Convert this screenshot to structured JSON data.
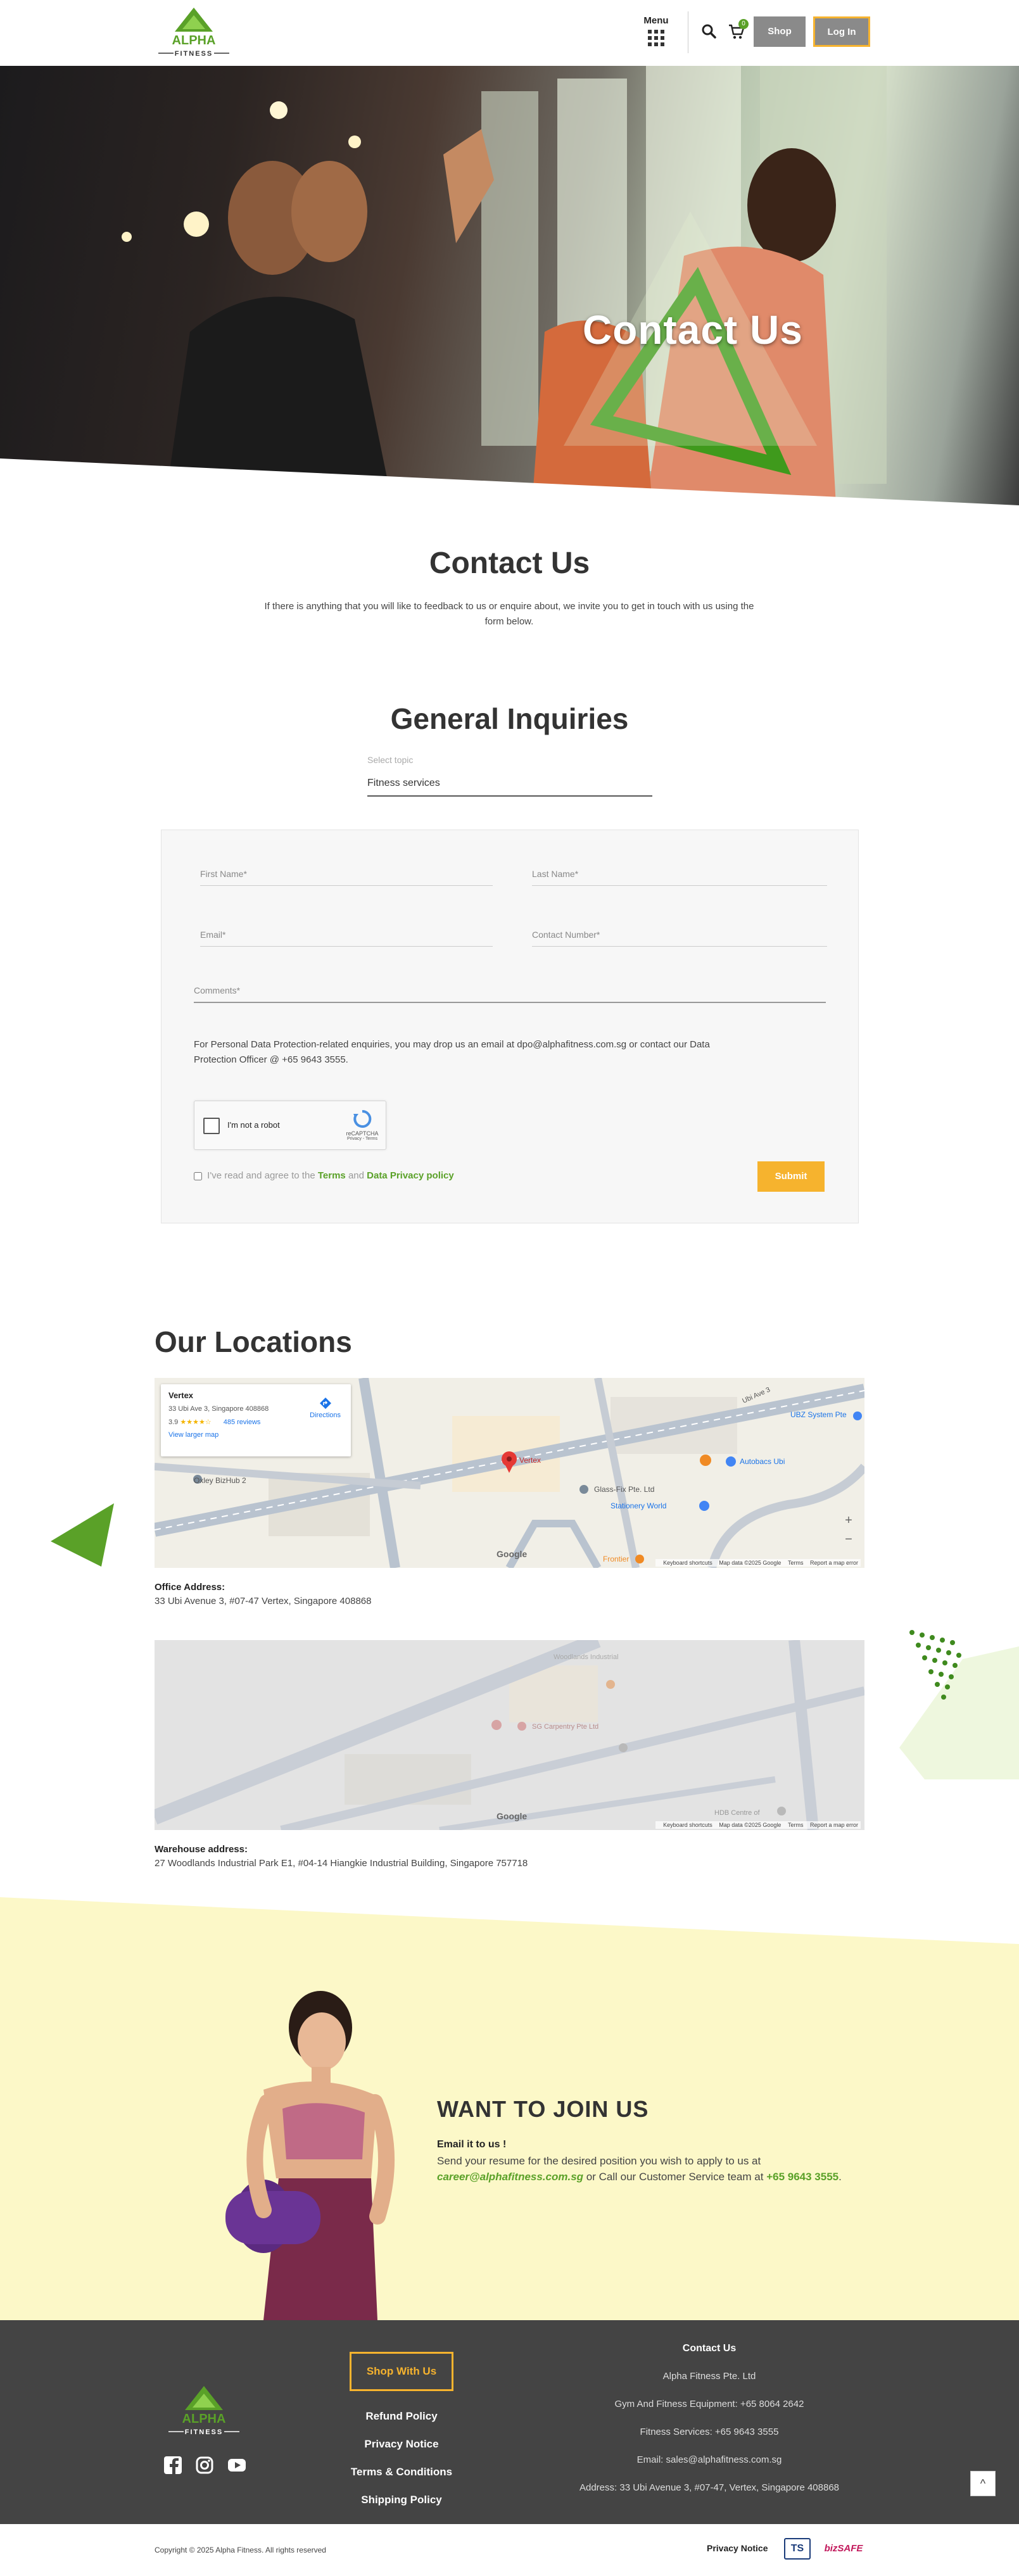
{
  "brand": {
    "logo_text": "ALPHA",
    "logo_sub": "FITNESS",
    "green": "#5aa128",
    "accent": "#f6b32e",
    "footer_bg": "#444444",
    "join_bg": "#fcf8c8"
  },
  "header": {
    "menu_label": "Menu",
    "cart_count": "0",
    "shop_label": "Shop",
    "login_label": "Log In",
    "icons": [
      "grid-icon",
      "search-icon",
      "cart-icon"
    ]
  },
  "hero": {
    "title": "Contact Us"
  },
  "intro": {
    "title": "Contact Us",
    "text": "If there is anything that you will like to feedback to us or enquire about, we invite you to get in touch with us using the form below."
  },
  "inquiries": {
    "title": "General Inquiries",
    "topic_label": "Select topic",
    "topic_value": "Fitness services"
  },
  "form": {
    "first_name": "First Name*",
    "last_name": "Last Name*",
    "email": "Email*",
    "contact_number": "Contact Number*",
    "comments": "Comments*",
    "dp_text": "For Personal Data Protection-related enquiries, you may drop us an email at dpo@alphafitness.com.sg or contact our Data Protection Officer @ +65 9643 3555.",
    "recaptcha_label": "I'm not a robot",
    "recaptcha_brand": "reCAPTCHA",
    "recaptcha_links": "Privacy - Terms",
    "agree_prefix": "I've read and agree to the",
    "agree_terms": "Terms",
    "agree_and": "and",
    "agree_privacy": "Data Privacy policy",
    "submit_label": "Submit"
  },
  "locations": {
    "title": "Our Locations",
    "map1": {
      "card_title": "Vertex",
      "card_address": "33 Ubi Ave 3, Singapore 408868",
      "rating": "3.9",
      "stars": "★★★★☆",
      "reviews": "485 reviews",
      "view_larger": "View larger map",
      "directions": "Directions",
      "labels": [
        "Vertex",
        "Glass-Fix Pte. Ltd",
        "Stationery World",
        "Autobacs Ubi",
        "UBZ System Pte",
        "Oxley BizHub 2",
        "Frontier",
        "Ubi Ave 3"
      ],
      "google": "Google",
      "footer": [
        "Keyboard shortcuts",
        "Map data ©2025 Google",
        "Terms",
        "Report a map error"
      ]
    },
    "office_label": "Office Address:",
    "office_address": "33 Ubi Avenue 3, #07-47 Vertex, Singapore 408868",
    "map2": {
      "labels": [
        "Woodlands Industrial",
        "SG Carpentry Pte Ltd",
        "HDB Centre of"
      ],
      "google": "Google",
      "footer": [
        "Keyboard shortcuts",
        "Map data ©2025 Google",
        "Terms",
        "Report a map error"
      ]
    },
    "warehouse_label": "Warehouse address:",
    "warehouse_address": "27 Woodlands Industrial Park E1, #04-14 Hiangkie Industrial Building, Singapore 757718"
  },
  "join": {
    "title": "WANT TO JOIN US",
    "subtitle": "Email it to us !",
    "text_1": "Send your resume for the desired position you wish to apply to us at",
    "email": "career@alphafitness.com.sg",
    "text_2": "or Call our Customer Service team at",
    "phone": "+65 9643 3555",
    "text_3": "."
  },
  "footer": {
    "shop_label": "Shop With Us",
    "links": [
      "Refund Policy",
      "Privacy Notice",
      "Terms & Conditions",
      "Shipping Policy"
    ],
    "contact_title": "Contact Us",
    "contact_lines": [
      "Alpha Fitness Pte. Ltd",
      "Gym And Fitness Equipment: +65 8064 2642",
      "Fitness Services: +65 9643 3555",
      "Email: sales@alphafitness.com.sg",
      "Address: 33 Ubi Avenue 3, #07-47, Vertex, Singapore 408868"
    ],
    "social": [
      "facebook-icon",
      "instagram-icon",
      "youtube-icon"
    ],
    "scroll_top": "^"
  },
  "bottom": {
    "copyright": "Copyright © 2025 Alpha Fitness. All rights reserved",
    "privacy": "Privacy Notice",
    "badge_ts": "TS",
    "badge_safe": "bizSAFE"
  }
}
